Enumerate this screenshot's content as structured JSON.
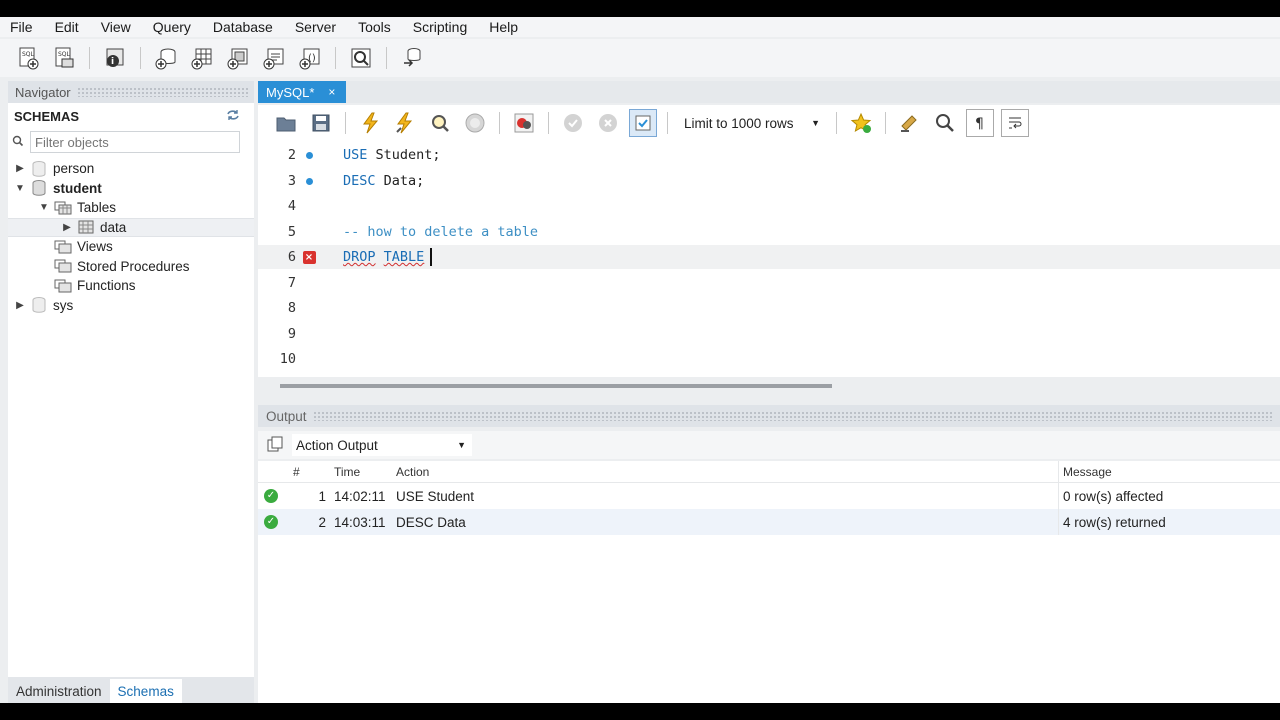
{
  "menu": [
    "File",
    "Edit",
    "View",
    "Query",
    "Database",
    "Server",
    "Tools",
    "Scripting",
    "Help"
  ],
  "main_toolbar_icons": [
    "new-sql-tab-icon",
    "open-sql-script-icon",
    "inspector-icon",
    "create-schema-icon",
    "create-table-icon",
    "create-view-icon",
    "create-procedure-icon",
    "create-function-icon",
    "search-table-data-icon",
    "reconnect-icon"
  ],
  "navigator": {
    "header": "Navigator",
    "schemas_title": "SCHEMAS",
    "filter_placeholder": "Filter objects",
    "tree": {
      "person": "person",
      "student": "student",
      "tables": "Tables",
      "data": "data",
      "views": "Views",
      "stored_procedures": "Stored Procedures",
      "functions": "Functions",
      "sys": "sys"
    },
    "tabs": {
      "administration": "Administration",
      "schemas": "Schemas"
    }
  },
  "editor_tab": {
    "title": "MySQL*",
    "close": "×"
  },
  "sql_toolbar": {
    "limit": "Limit to 1000 rows"
  },
  "editor": {
    "lines": [
      {
        "n": "2",
        "marker": "dot"
      },
      {
        "n": "3",
        "marker": "dot"
      },
      {
        "n": "4",
        "marker": ""
      },
      {
        "n": "5",
        "marker": ""
      },
      {
        "n": "6",
        "marker": "error"
      },
      {
        "n": "7",
        "marker": ""
      },
      {
        "n": "8",
        "marker": ""
      },
      {
        "n": "9",
        "marker": ""
      },
      {
        "n": "10",
        "marker": ""
      }
    ],
    "code": {
      "l2_kw": "USE",
      "l2_rest": " Student;",
      "l3_kw": "DESC",
      "l3_rest": " Data;",
      "l5_comment": "-- how to delete a table",
      "l6_drop": "DROP",
      "l6_table": "TABLE"
    }
  },
  "output": {
    "header": "Output",
    "selector": "Action Output",
    "columns": {
      "num": "#",
      "time": "Time",
      "action": "Action",
      "message": "Message"
    },
    "rows": [
      {
        "num": "1",
        "time": "14:02:11",
        "action": "USE Student",
        "message": "0 row(s) affected",
        "status": "success"
      },
      {
        "num": "2",
        "time": "14:03:11",
        "action": "DESC Data",
        "message": "4 row(s) returned",
        "status": "success"
      }
    ]
  },
  "colors": {
    "accent": "#2a8fd6",
    "keyword": "#1a6db5",
    "comment": "#3d8fc4",
    "error": "#d9322e",
    "success": "#3aab3f"
  }
}
